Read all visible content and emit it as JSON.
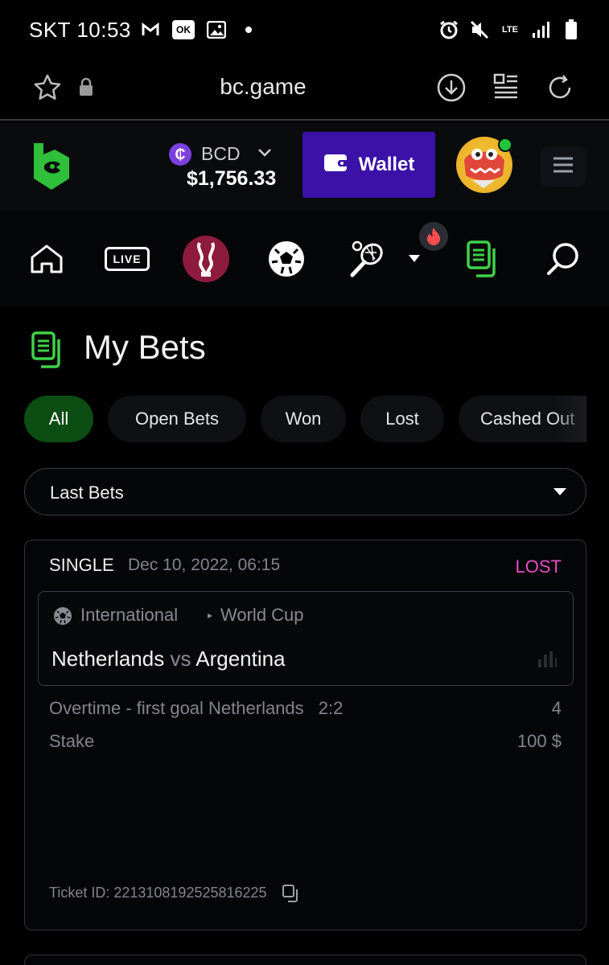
{
  "status_bar": {
    "carrier_time": "SKT 10:53",
    "network": "LTE",
    "icons": [
      "gmail-icon",
      "ok-icon",
      "gallery-icon",
      "dot-icon",
      "alarm-icon",
      "mute-icon",
      "lte-icon",
      "signal-icon",
      "battery-icon"
    ]
  },
  "browser": {
    "url": "bc.game",
    "icons": [
      "star-icon",
      "lock-icon",
      "download-icon",
      "reader-icon",
      "reload-icon"
    ]
  },
  "header": {
    "currency_symbol": "₵",
    "currency": "BCD",
    "balance": "$1,756.33",
    "wallet_label": "Wallet",
    "accent_color": "#3b11a8",
    "logo_color": "#2fbf3a"
  },
  "sport_nav": {
    "items": [
      "home-icon",
      "live-icon",
      "world-cup-icon",
      "soccer-icon",
      "tennis-icon",
      "more-icon",
      "fire-icon",
      "my-bets-icon",
      "search-icon"
    ],
    "live_label": "LIVE",
    "active_color": "#3fd14a"
  },
  "page": {
    "title": "My Bets"
  },
  "tabs": [
    {
      "label": "All",
      "active": true
    },
    {
      "label": "Open Bets",
      "active": false
    },
    {
      "label": "Won",
      "active": false
    },
    {
      "label": "Lost",
      "active": false
    },
    {
      "label": "Cashed Out",
      "active": false
    }
  ],
  "filter": {
    "selected": "Last Bets"
  },
  "bet": {
    "type": "SINGLE",
    "date": "Dec 10, 2022, 06:15",
    "status": "LOST",
    "status_color": "#e24ec6",
    "league": "International",
    "competition": "World Cup",
    "home": "Netherlands",
    "vs": "vs",
    "away": "Argentina",
    "selection": "Overtime - first goal Netherlands",
    "score": "2:2",
    "odds": "4",
    "stake_label": "Stake",
    "stake_value": "100 $",
    "ticket_id": "Ticket ID: 2213108192525816225"
  }
}
